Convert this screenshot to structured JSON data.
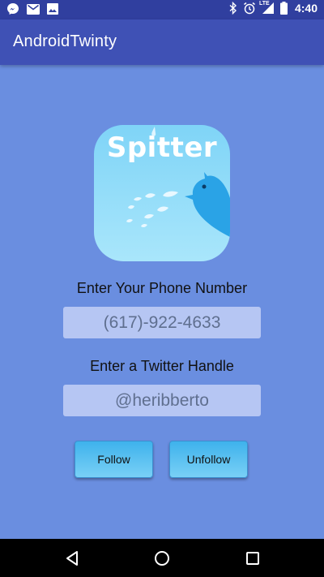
{
  "status_bar": {
    "time": "4:40",
    "network_label": "LTE",
    "notification_icons": [
      "messenger-icon",
      "mail-icon",
      "image-icon"
    ],
    "system_icons": [
      "bluetooth-icon",
      "alarm-icon",
      "signal-icon",
      "battery-icon"
    ]
  },
  "app_bar": {
    "title": "AndroidTwinty"
  },
  "logo": {
    "text": "Spitter",
    "colors": {
      "bg_top": "#7fd4f7",
      "bg_bottom": "#a9e6fb",
      "bird": "#2aa3e6"
    }
  },
  "form": {
    "phone_label": "Enter Your Phone Number",
    "phone_value": "(617)-922-4633",
    "handle_label": "Enter a Twitter Handle",
    "handle_value": "@heribberto"
  },
  "buttons": {
    "follow_label": "Follow",
    "unfollow_label": "Unfollow"
  },
  "colors": {
    "background": "#6a8ee0",
    "app_bar": "#3f51b5",
    "status_bar": "#303f9f",
    "button": "#3eb2ec"
  },
  "nav_bar": {
    "icons": [
      "back-icon",
      "home-icon",
      "recents-icon"
    ]
  }
}
